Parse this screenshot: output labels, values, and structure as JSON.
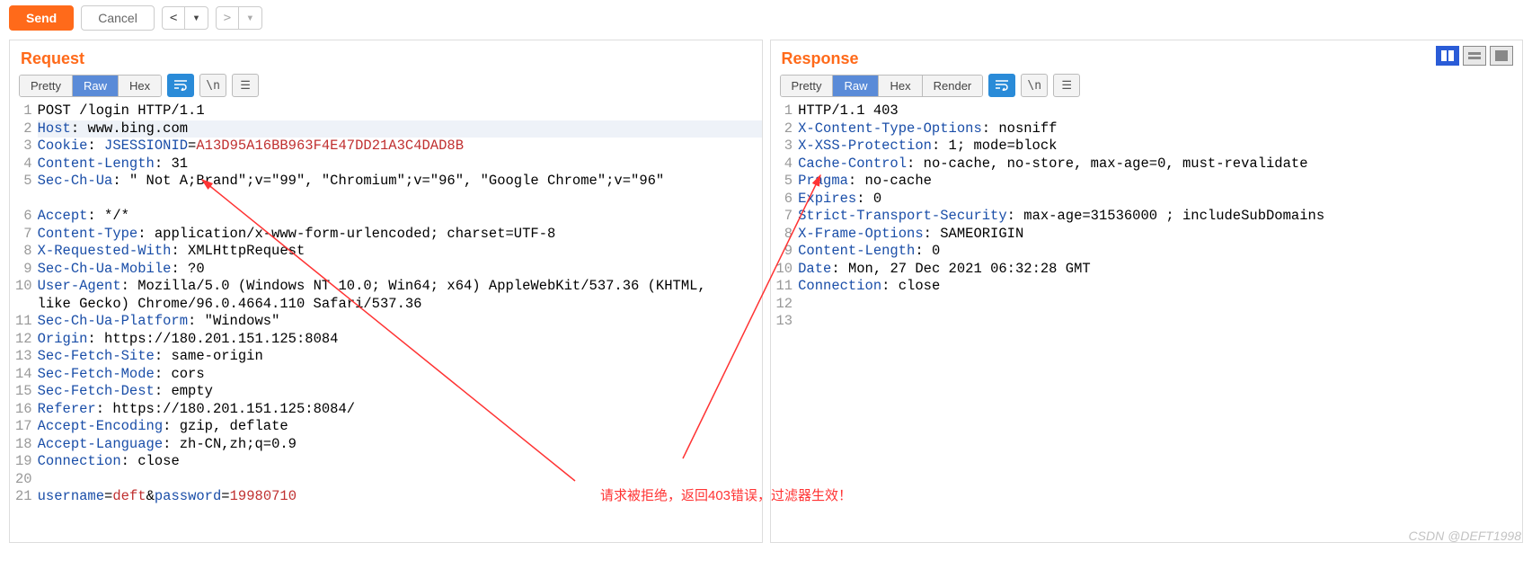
{
  "toolbar": {
    "send": "Send",
    "cancel": "Cancel"
  },
  "request": {
    "title": "Request",
    "tabs": {
      "pretty": "Pretty",
      "raw": "Raw",
      "hex": "Hex"
    },
    "newline_label": "\\n",
    "lines": [
      [
        {
          "t": "POST /login HTTP/1.1",
          "c": ""
        }
      ],
      [
        {
          "t": "Host",
          "c": "hn"
        },
        {
          "t": ": ",
          "c": ""
        },
        {
          "t": "www.bing.com",
          "c": "hv"
        }
      ],
      [
        {
          "t": "Cookie",
          "c": "hn"
        },
        {
          "t": ": ",
          "c": ""
        },
        {
          "t": "JSESSIONID",
          "c": "hn"
        },
        {
          "t": "=",
          "c": ""
        },
        {
          "t": "A13D95A16BB963F4E47DD21A3C4DAD8B",
          "c": "ck"
        }
      ],
      [
        {
          "t": "Content-Length",
          "c": "hn"
        },
        {
          "t": ": ",
          "c": ""
        },
        {
          "t": "31",
          "c": "hv"
        }
      ],
      [
        {
          "t": "Sec-Ch-Ua",
          "c": "hn"
        },
        {
          "t": ": ",
          "c": ""
        },
        {
          "t": "\" Not A;Brand\";v=\"99\", \"Chromium\";v=\"96\", \"Google Chrome\";v=\"96\"",
          "c": "hv"
        }
      ],
      [
        {
          "t": "Accept",
          "c": "hn"
        },
        {
          "t": ": ",
          "c": ""
        },
        {
          "t": "*/*",
          "c": "hv"
        }
      ],
      [
        {
          "t": "Content-Type",
          "c": "hn"
        },
        {
          "t": ": ",
          "c": ""
        },
        {
          "t": "application/x-www-form-urlencoded; charset=UTF-8",
          "c": "hv"
        }
      ],
      [
        {
          "t": "X-Requested-With",
          "c": "hn"
        },
        {
          "t": ": ",
          "c": ""
        },
        {
          "t": "XMLHttpRequest",
          "c": "hv"
        }
      ],
      [
        {
          "t": "Sec-Ch-Ua-Mobile",
          "c": "hn"
        },
        {
          "t": ": ",
          "c": ""
        },
        {
          "t": "?0",
          "c": "hv"
        }
      ],
      [
        {
          "t": "User-Agent",
          "c": "hn"
        },
        {
          "t": ": ",
          "c": ""
        },
        {
          "t": "Mozilla/5.0 (Windows NT 10.0; Win64; x64) AppleWebKit/537.36 (KHTML, like Gecko) Chrome/96.0.4664.110 Safari/537.36",
          "c": "hv"
        }
      ],
      [
        {
          "t": "Sec-Ch-Ua-Platform",
          "c": "hn"
        },
        {
          "t": ": ",
          "c": ""
        },
        {
          "t": "\"Windows\"",
          "c": "hv"
        }
      ],
      [
        {
          "t": "Origin",
          "c": "hn"
        },
        {
          "t": ": ",
          "c": ""
        },
        {
          "t": "https://180.201.151.125:8084",
          "c": "hv"
        }
      ],
      [
        {
          "t": "Sec-Fetch-Site",
          "c": "hn"
        },
        {
          "t": ": ",
          "c": ""
        },
        {
          "t": "same-origin",
          "c": "hv"
        }
      ],
      [
        {
          "t": "Sec-Fetch-Mode",
          "c": "hn"
        },
        {
          "t": ": ",
          "c": ""
        },
        {
          "t": "cors",
          "c": "hv"
        }
      ],
      [
        {
          "t": "Sec-Fetch-Dest",
          "c": "hn"
        },
        {
          "t": ": ",
          "c": ""
        },
        {
          "t": "empty",
          "c": "hv"
        }
      ],
      [
        {
          "t": "Referer",
          "c": "hn"
        },
        {
          "t": ": ",
          "c": ""
        },
        {
          "t": "https://180.201.151.125:8084/",
          "c": "hv"
        }
      ],
      [
        {
          "t": "Accept-Encoding",
          "c": "hn"
        },
        {
          "t": ": ",
          "c": ""
        },
        {
          "t": "gzip, deflate",
          "c": "hv"
        }
      ],
      [
        {
          "t": "Accept-Language",
          "c": "hn"
        },
        {
          "t": ": ",
          "c": ""
        },
        {
          "t": "zh-CN,zh;q=0.9",
          "c": "hv"
        }
      ],
      [
        {
          "t": "Connection",
          "c": "hn"
        },
        {
          "t": ": ",
          "c": ""
        },
        {
          "t": "close",
          "c": "hv"
        }
      ],
      [
        {
          "t": "",
          "c": ""
        }
      ],
      [
        {
          "t": "username",
          "c": "hn"
        },
        {
          "t": "=",
          "c": ""
        },
        {
          "t": "deft",
          "c": "ck"
        },
        {
          "t": "&",
          "c": ""
        },
        {
          "t": "password",
          "c": "hn"
        },
        {
          "t": "=",
          "c": ""
        },
        {
          "t": "19980710",
          "c": "ck"
        }
      ]
    ],
    "highlight_line": 2
  },
  "response": {
    "title": "Response",
    "tabs": {
      "pretty": "Pretty",
      "raw": "Raw",
      "hex": "Hex",
      "render": "Render"
    },
    "newline_label": "\\n",
    "lines": [
      [
        {
          "t": "HTTP/1.1 403 ",
          "c": ""
        }
      ],
      [
        {
          "t": "X-Content-Type-Options",
          "c": "hn"
        },
        {
          "t": ": ",
          "c": ""
        },
        {
          "t": "nosniff",
          "c": "hv"
        }
      ],
      [
        {
          "t": "X-XSS-Protection",
          "c": "hn"
        },
        {
          "t": ": ",
          "c": ""
        },
        {
          "t": "1; mode=block",
          "c": "hv"
        }
      ],
      [
        {
          "t": "Cache-Control",
          "c": "hn"
        },
        {
          "t": ": ",
          "c": ""
        },
        {
          "t": "no-cache, no-store, max-age=0, must-revalidate",
          "c": "hv"
        }
      ],
      [
        {
          "t": "Pragma",
          "c": "hn"
        },
        {
          "t": ": ",
          "c": ""
        },
        {
          "t": "no-cache",
          "c": "hv"
        }
      ],
      [
        {
          "t": "Expires",
          "c": "hn"
        },
        {
          "t": ": ",
          "c": ""
        },
        {
          "t": "0",
          "c": "hv"
        }
      ],
      [
        {
          "t": "Strict-Transport-Security",
          "c": "hn"
        },
        {
          "t": ": ",
          "c": ""
        },
        {
          "t": "max-age=31536000 ; includeSubDomains",
          "c": "hv"
        }
      ],
      [
        {
          "t": "X-Frame-Options",
          "c": "hn"
        },
        {
          "t": ": ",
          "c": ""
        },
        {
          "t": "SAMEORIGIN",
          "c": "hv"
        }
      ],
      [
        {
          "t": "Content-Length",
          "c": "hn"
        },
        {
          "t": ": ",
          "c": ""
        },
        {
          "t": "0",
          "c": "hv"
        }
      ],
      [
        {
          "t": "Date",
          "c": "hn"
        },
        {
          "t": ": ",
          "c": ""
        },
        {
          "t": "Mon, 27 Dec 2021 06:32:28 GMT",
          "c": "hv"
        }
      ],
      [
        {
          "t": "Connection",
          "c": "hn"
        },
        {
          "t": ": ",
          "c": ""
        },
        {
          "t": "close",
          "c": "hv"
        }
      ],
      [
        {
          "t": "",
          "c": ""
        }
      ],
      [
        {
          "t": "",
          "c": ""
        }
      ]
    ]
  },
  "annotation": {
    "text": "请求被拒绝，返回403错误，过滤器生效！"
  },
  "watermark": "CSDN @DEFT1998"
}
